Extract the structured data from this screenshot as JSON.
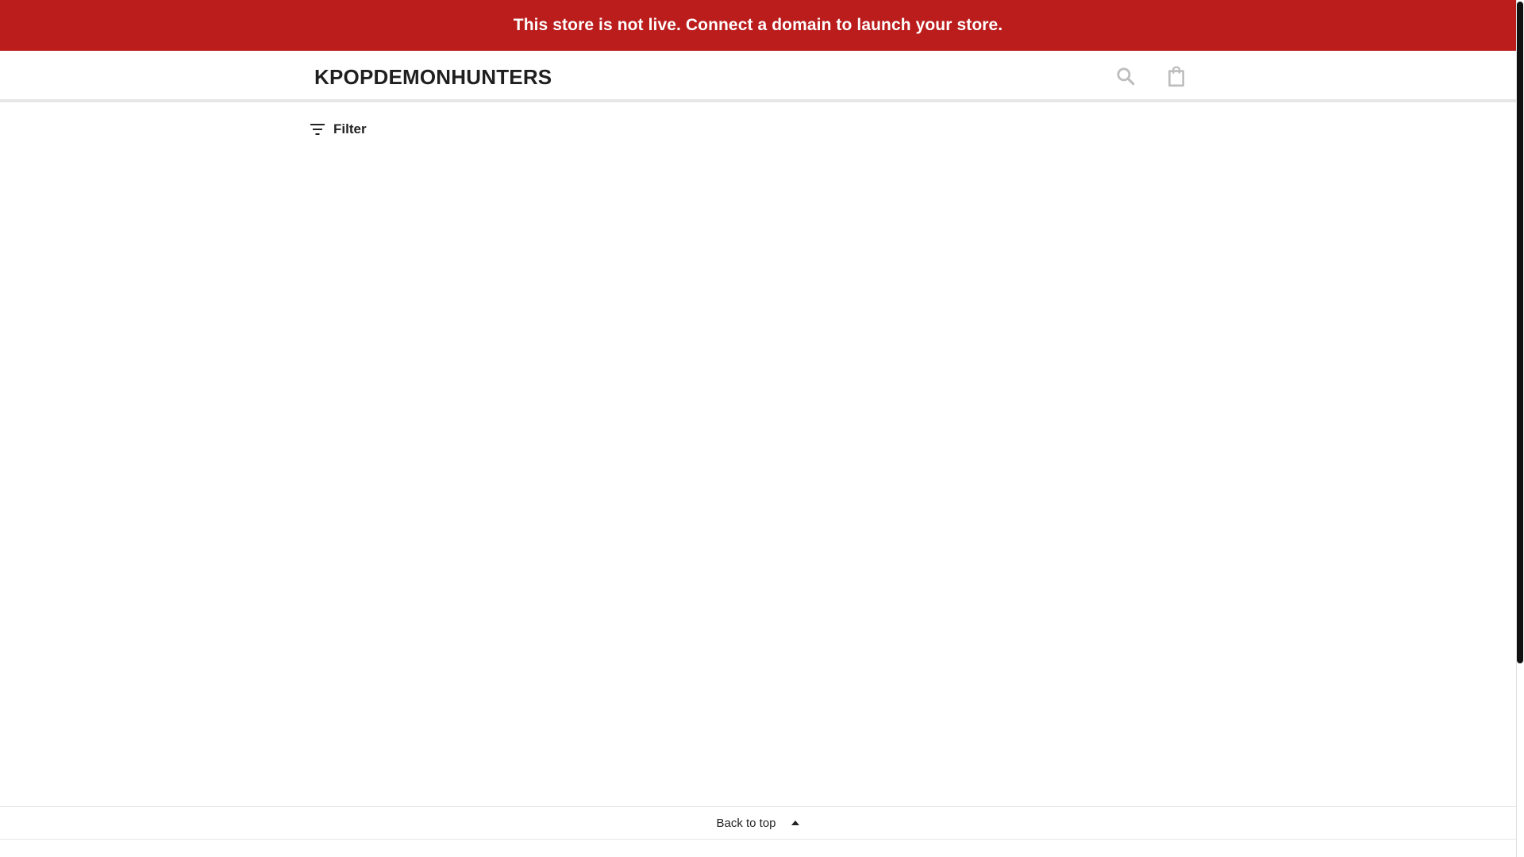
{
  "banner": {
    "text": "This store is not live. Connect a domain to launch your store.",
    "background_color": "#bb1c1c"
  },
  "header": {
    "store_name": "KPOPDEMONHUNTERS",
    "icons": {
      "search": "search-icon",
      "cart": "shopping-bag-icon"
    }
  },
  "toolbar": {
    "filter_label": "Filter",
    "filter_icon": "filter-icon"
  },
  "footer": {
    "back_to_top_label": "Back to top",
    "back_to_top_icon": "caret-up-icon"
  }
}
